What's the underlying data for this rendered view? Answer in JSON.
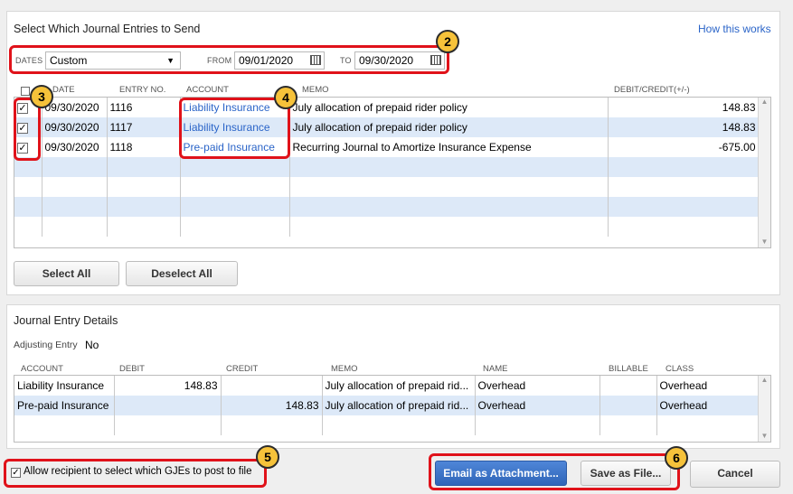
{
  "top_panel": {
    "title": "Select Which Journal Entries to Send",
    "help_link": "How this works",
    "dates_label": "DATES",
    "dates_value": "Custom",
    "from_label": "FROM",
    "from_value": "09/01/2020",
    "to_label": "TO",
    "to_value": "09/30/2020",
    "columns": [
      "DATE",
      "ENTRY NO.",
      "ACCOUNT",
      "MEMO",
      "DEBIT/CREDIT(+/-)"
    ],
    "rows": [
      {
        "checked": true,
        "date": "09/30/2020",
        "entry_no": "1116",
        "account": "Liability Insurance",
        "memo": "July allocation of prepaid rider policy",
        "amount": "148.83"
      },
      {
        "checked": true,
        "date": "09/30/2020",
        "entry_no": "1117",
        "account": "Liability Insurance",
        "memo": "July allocation of prepaid rider policy",
        "amount": "148.83"
      },
      {
        "checked": true,
        "date": "09/30/2020",
        "entry_no": "1118",
        "account": "Pre-paid Insurance",
        "memo": "Recurring Journal to Amortize Insurance Expense",
        "amount": "-675.00"
      }
    ],
    "select_all_label": "Select All",
    "deselect_all_label": "Deselect All"
  },
  "details_panel": {
    "title": "Journal Entry Details",
    "adjusting_label": "Adjusting Entry",
    "adjusting_value": "No",
    "columns": [
      "ACCOUNT",
      "DEBIT",
      "CREDIT",
      "MEMO",
      "NAME",
      "BILLABLE",
      "CLASS"
    ],
    "rows": [
      {
        "account": "Liability Insurance",
        "debit": "148.83",
        "credit": "",
        "memo": "July allocation of prepaid rid...",
        "name": "Overhead",
        "billable": "",
        "class": "Overhead"
      },
      {
        "account": "Pre-paid Insurance",
        "debit": "",
        "credit": "148.83",
        "memo": "July allocation of prepaid rid...",
        "name": "Overhead",
        "billable": "",
        "class": "Overhead"
      }
    ]
  },
  "footer": {
    "allow_label": "Allow recipient to select which GJEs to post to file",
    "email_label": "Email as Attachment...",
    "save_label": "Save as File...",
    "cancel_label": "Cancel"
  },
  "callouts": [
    "2",
    "3",
    "4",
    "5",
    "6"
  ],
  "colors": {
    "accent_link": "#2a64c8",
    "callout_red": "#e0121a",
    "badge_yellow": "#f6c23a",
    "row_alt": "#dde9f8",
    "primary_button": "#2f65b8"
  }
}
